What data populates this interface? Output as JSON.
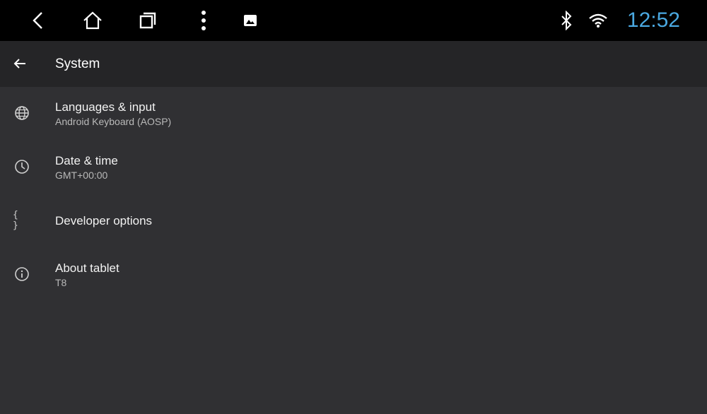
{
  "status_bar": {
    "nav_icons": [
      "back-icon",
      "home-icon",
      "recents-icon",
      "more-vert-icon",
      "image-icon"
    ],
    "status_icons": [
      "bluetooth-icon",
      "wifi-icon"
    ],
    "clock": "12:52",
    "clock_color": "#4aa8e0"
  },
  "app_bar": {
    "title": "System",
    "back_icon": "arrow-left-icon"
  },
  "settings": {
    "items": [
      {
        "icon": "globe-icon",
        "title": "Languages & input",
        "subtitle": "Android Keyboard (AOSP)"
      },
      {
        "icon": "clock-icon",
        "title": "Date & time",
        "subtitle": "GMT+00:00"
      },
      {
        "icon": "braces-icon",
        "icon_text": "{ }",
        "title": "Developer options",
        "subtitle": ""
      },
      {
        "icon": "info-icon",
        "title": "About tablet",
        "subtitle": "T8"
      }
    ]
  },
  "colors": {
    "status_bar_bg": "#000000",
    "app_bar_bg": "#252527",
    "content_bg": "#303033"
  }
}
